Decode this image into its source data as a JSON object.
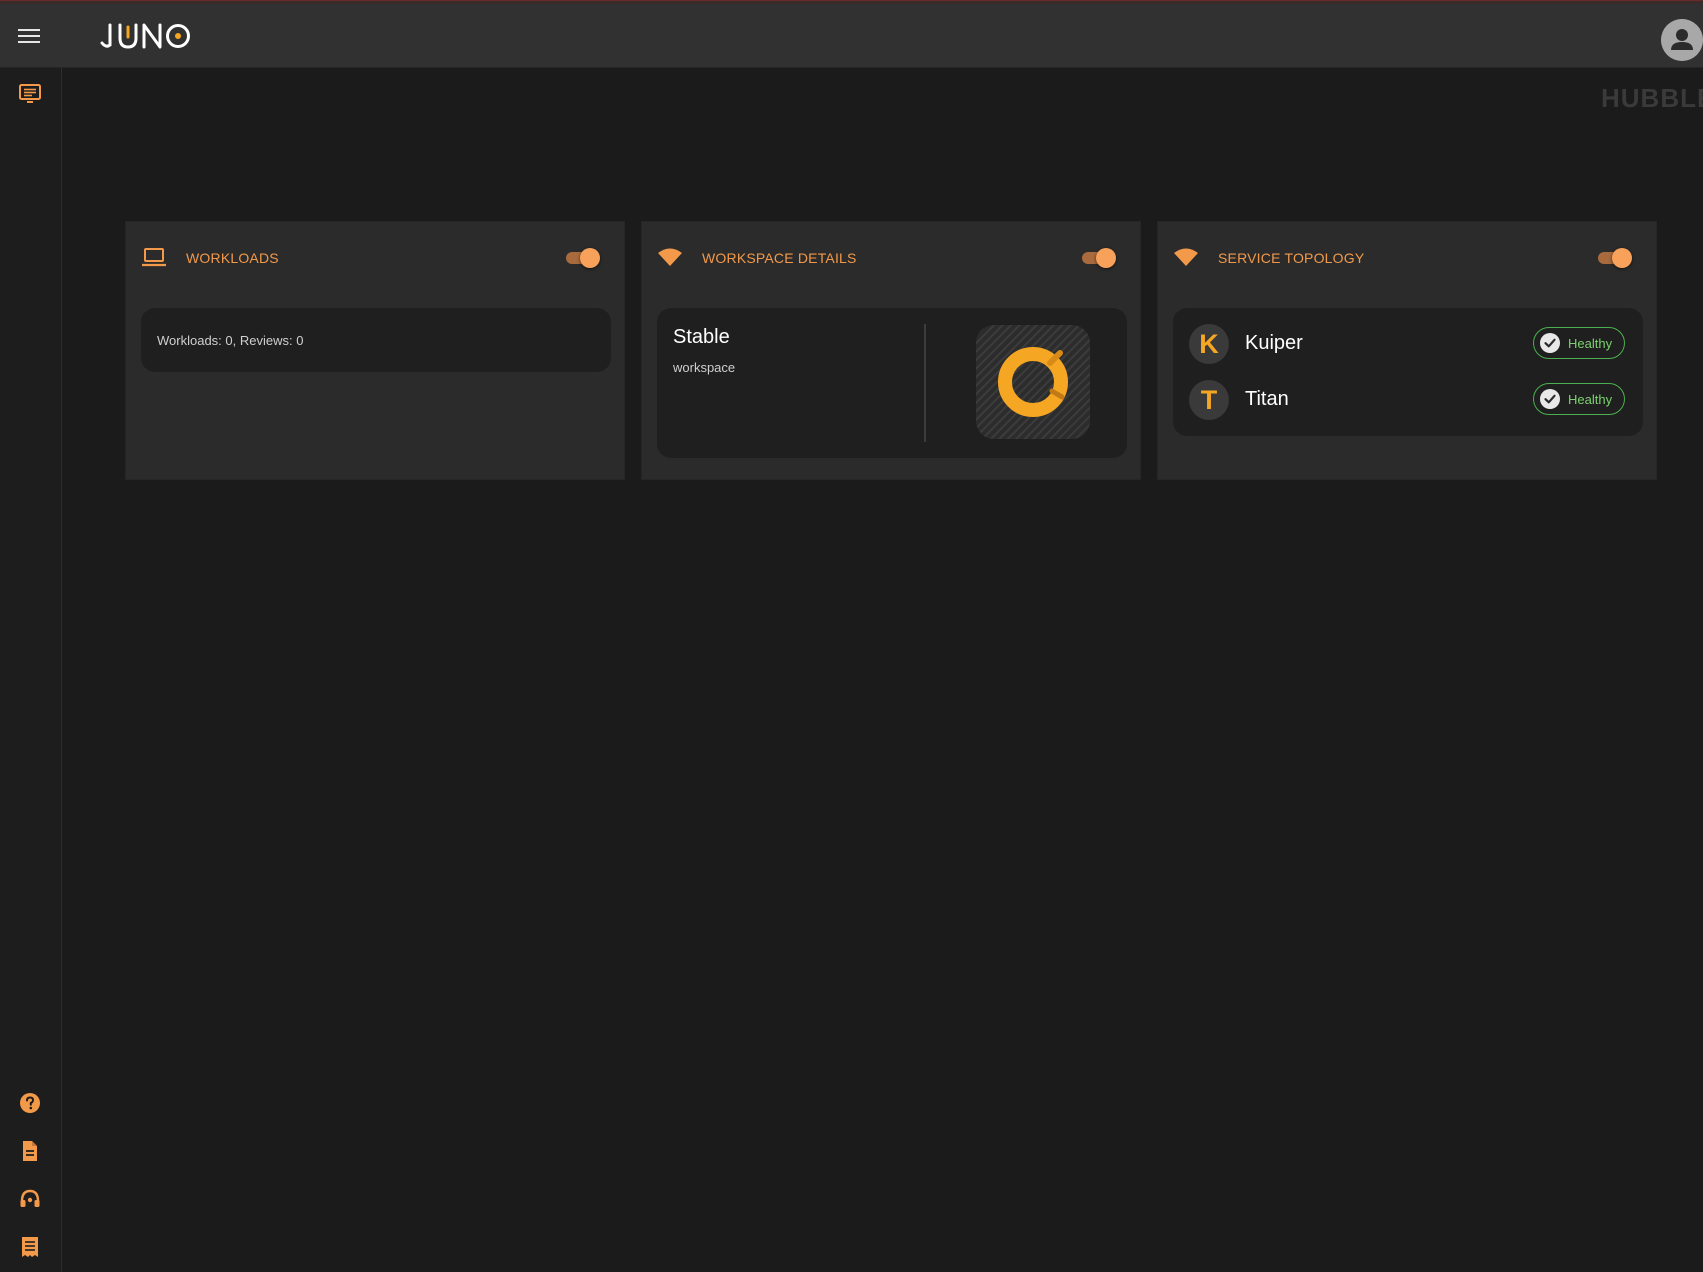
{
  "header": {
    "brand": "JUNO",
    "watermark": "HUBBLE"
  },
  "cards": {
    "workloads": {
      "title": "WORKLOADS",
      "summary": "Workloads: 0, Reviews: 0",
      "enabled": true
    },
    "workspace": {
      "title": "WORKSPACE DETAILS",
      "name": "Stable",
      "type": "workspace",
      "enabled": true
    },
    "topology": {
      "title": "SERVICE TOPOLOGY",
      "enabled": true,
      "services": [
        {
          "initial": "K",
          "name": "Kuiper",
          "status": "Healthy"
        },
        {
          "initial": "T",
          "name": "Titan",
          "status": "Healthy"
        }
      ]
    }
  },
  "icons": {
    "sidebar_top": [
      "dashboard-icon"
    ],
    "sidebar_bottom": [
      "help-icon",
      "document-icon",
      "support-icon",
      "receipt-icon"
    ]
  },
  "colors": {
    "accent": "#f2994a",
    "logo_orange": "#f5a623",
    "status_green": "#7cd16f",
    "background": "#1b1b1b",
    "card": "#2b2b2b"
  }
}
